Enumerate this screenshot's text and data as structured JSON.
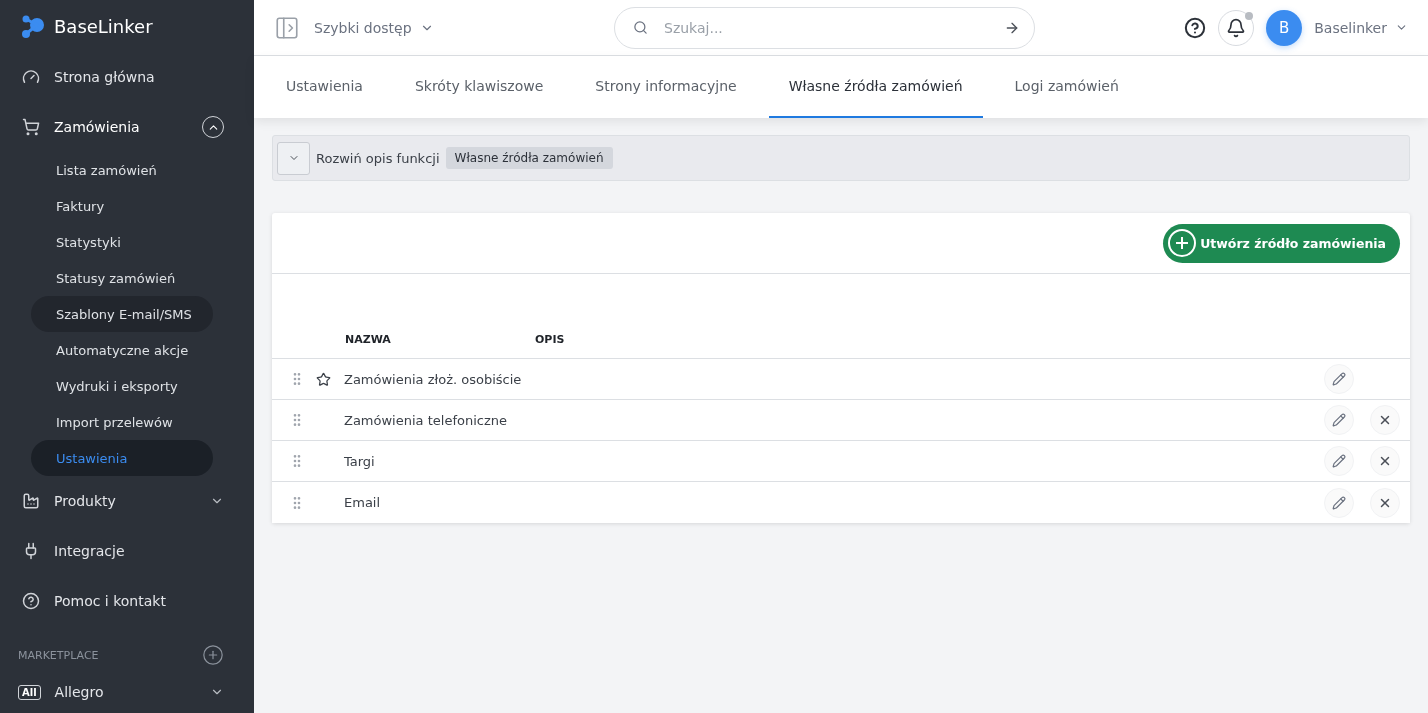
{
  "sidebar": {
    "logo": "BaseLinker",
    "items": [
      {
        "label": "Strona główna"
      },
      {
        "label": "Zamówienia",
        "expanded": true,
        "children": [
          {
            "label": "Lista zamówień",
            "selected": false,
            "hovered": false
          },
          {
            "label": "Faktury",
            "selected": false,
            "hovered": false
          },
          {
            "label": "Statystyki",
            "selected": false,
            "hovered": false
          },
          {
            "label": "Statusy zamówień",
            "selected": false,
            "hovered": false
          },
          {
            "label": "Szablony E-mail/SMS",
            "selected": false,
            "hovered": true
          },
          {
            "label": "Automatyczne akcje",
            "selected": false,
            "hovered": false
          },
          {
            "label": "Wydruki i eksporty",
            "selected": false,
            "hovered": false
          },
          {
            "label": "Import przelewów",
            "selected": false,
            "hovered": false
          },
          {
            "label": "Ustawienia",
            "selected": true,
            "hovered": false
          }
        ]
      },
      {
        "label": "Produkty",
        "expanded": false
      },
      {
        "label": "Integracje"
      },
      {
        "label": "Pomoc i kontakt"
      }
    ],
    "section": "MARKETPLACE",
    "marketplace": [
      {
        "badge": "All",
        "label": "Allegro",
        "expanded": false
      }
    ]
  },
  "topbar": {
    "quick_access": "Szybki dostęp",
    "search": {
      "placeholder": "Szukaj..."
    },
    "avatar": "B",
    "user": "Baselinker",
    "notification_dot": true
  },
  "tabs": [
    {
      "label": "Ustawienia",
      "selected": false
    },
    {
      "label": "Skróty klawiszowe",
      "selected": false
    },
    {
      "label": "Strony informacyjne",
      "selected": false
    },
    {
      "label": "Własne źródła zamówień",
      "selected": true
    },
    {
      "label": "Logi zamówień",
      "selected": false
    }
  ],
  "description_bar": {
    "label": "Rozwiń opis funkcji",
    "tag": "Własne źródła zamówień"
  },
  "create_button": "Utwórz źródło zamówienia",
  "table": {
    "columns": [
      "NAZWA",
      "OPIS"
    ],
    "rows": [
      {
        "name": "Zamówienia złoż. osobiście",
        "starred": true,
        "deletable": false
      },
      {
        "name": "Zamówienia telefoniczne",
        "starred": false,
        "deletable": true
      },
      {
        "name": "Targi",
        "starred": false,
        "deletable": true
      },
      {
        "name": "Email",
        "starred": false,
        "deletable": true
      }
    ]
  }
}
